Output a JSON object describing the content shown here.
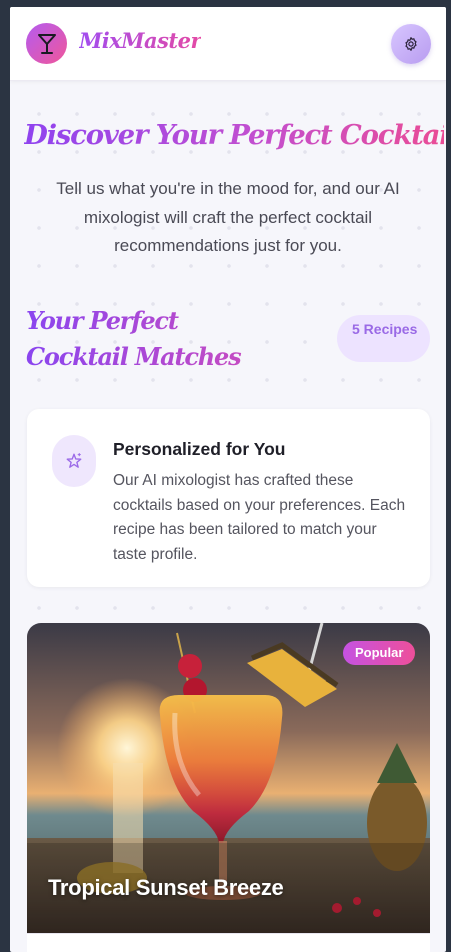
{
  "header": {
    "brand": "MixMaster",
    "logo_icon": "cocktail-glass-icon",
    "settings_icon": "gear-icon"
  },
  "hero": {
    "title": "Discover Your Perfect Cocktail",
    "subtitle": "Tell us what you're in the mood for, and our AI mixologist will craft the perfect cocktail recommendations just for you."
  },
  "matches": {
    "title": "Your Perfect Cocktail Matches",
    "count_label": "5 Recipes"
  },
  "info_card": {
    "icon": "sparkle-star-icon",
    "title": "Personalized for You",
    "text": "Our AI mixologist has crafted these cocktails based on your preferences. Each recipe has been tailored to match your taste profile."
  },
  "cocktails": [
    {
      "name": "Tropical Sunset Breeze",
      "badge": "Popular"
    }
  ],
  "colors": {
    "accent_purple": "#9b4df0",
    "accent_pink": "#ea4c95",
    "pill_bg": "#ede3ff",
    "page_bg": "#f6f6fb"
  }
}
